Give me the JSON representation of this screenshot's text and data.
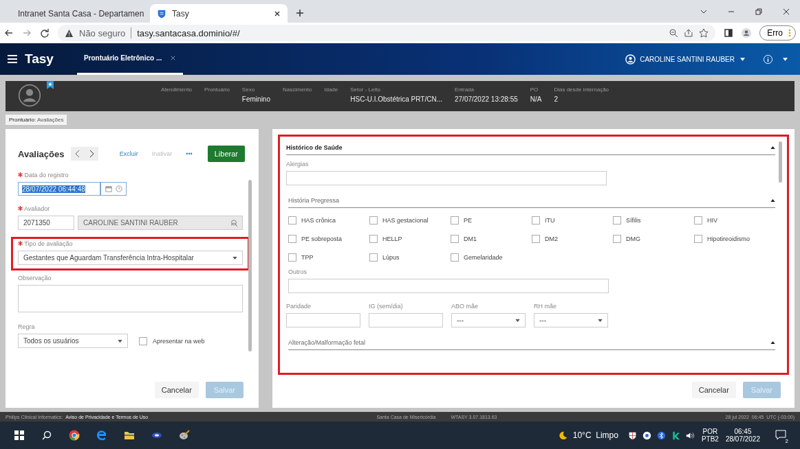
{
  "browser": {
    "tabs": [
      {
        "title": "Intranet Santa Casa - Departamen",
        "selected": false
      },
      {
        "title": "Tasy",
        "selected": true
      }
    ],
    "address": {
      "warning": "Não seguro",
      "url": "tasy.santacasa.dominio/#/"
    },
    "profile_button": "Erro"
  },
  "app_header": {
    "logo": "Tasy",
    "tab": "Prontuário Eletrônico ...",
    "user": "CAROLINE SANTINI RAUBER"
  },
  "patient_bar": [
    {
      "label": "Atendimento"
    },
    {
      "label": "Prontuário"
    },
    {
      "label": "Sexo",
      "value": "Feminino"
    },
    {
      "label": "Nascimento"
    },
    {
      "label": "Idade"
    },
    {
      "label": "Setor - Leito",
      "value": "HSC-U.I.Obstétrica PRT/CN..."
    },
    {
      "label": "Entrada",
      "value": "27/07/2022 13:28:55"
    },
    {
      "label": "PO",
      "value": "N/A"
    },
    {
      "label": "Dias desde internação",
      "value": "2"
    }
  ],
  "breadcrumb": {
    "prefix": "Prontuário:",
    "current": "Avaliações"
  },
  "left_panel": {
    "title": "Avaliações",
    "actions": [
      {
        "label": "Excluir",
        "disabled": false
      },
      {
        "label": "Inativar",
        "disabled": true
      },
      {
        "label": "•••",
        "disabled": false
      }
    ],
    "primary_button": "Liberar",
    "date_field": {
      "label": "Data do registro",
      "required": true,
      "value": "28/07/2022 06:44:48"
    },
    "evaluator_field": {
      "label": "Avaliador",
      "required": true,
      "code": "2071350",
      "name": "CAROLINE SANTINI RAUBER"
    },
    "type_field": {
      "label": "Tipo de avaliação",
      "required": true,
      "value": "Gestantes que Aguardam Transferência Intra-Hospitalar",
      "highlighted": true
    },
    "observation_field": {
      "label": "Observação"
    },
    "rule_field": {
      "label": "Regra",
      "value": "Todos os usuários"
    },
    "web_checkbox": {
      "label": "Apresentar na web",
      "checked": false
    },
    "buttons": [
      {
        "label": "Cancelar",
        "disabled": false
      },
      {
        "label": "Salvar",
        "disabled": true
      }
    ]
  },
  "right_panel": {
    "highlighted": true,
    "section": "Histórico de Saúde",
    "allergies_label": "Alergias",
    "subsection": "História Pregressa",
    "checkboxes": [
      {
        "label": "HAS crônica",
        "checked": false
      },
      {
        "label": "HAS gestacional",
        "checked": false
      },
      {
        "label": "PE",
        "checked": false
      },
      {
        "label": "ITU",
        "checked": false
      },
      {
        "label": "Sífilis",
        "checked": false
      },
      {
        "label": "HIV",
        "checked": false
      },
      {
        "label": "PE sobreposta",
        "checked": false
      },
      {
        "label": "HELLP",
        "checked": false
      },
      {
        "label": "DM1",
        "checked": false
      },
      {
        "label": "DM2",
        "checked": false
      },
      {
        "label": "DMG",
        "checked": false
      },
      {
        "label": "Hipotireoidismo",
        "checked": false
      },
      {
        "label": "TPP",
        "checked": false
      },
      {
        "label": "Lúpus",
        "checked": false
      },
      {
        "label": "Gemelaridade",
        "checked": false
      }
    ],
    "others_label": "Outros",
    "small_fields": [
      {
        "label": "Paridade",
        "kind": "input"
      },
      {
        "label": "IG (sem/dia)",
        "kind": "input"
      },
      {
        "label": "ABO mãe",
        "kind": "select",
        "value": "---"
      },
      {
        "label": "RH mãe",
        "kind": "select",
        "value": "---"
      }
    ],
    "next_section": "Alteração/Malformação fetal",
    "buttons": [
      {
        "label": "Cancelar",
        "disabled": false
      },
      {
        "label": "Salvar",
        "disabled": true
      }
    ]
  },
  "status_bar": {
    "company": "Philips Clinical Informatics:",
    "link": "Aviso de Privacidade e Termos de Uso",
    "institution": "Santa Casa de Misericórdia",
    "version": "WTASY 3.07.1813.63",
    "datetime": "28 jul 2022  06:45  UTC (-03:00)"
  },
  "taskbar": {
    "weather": "10°C  Limpo",
    "language": "POR",
    "layout": "PTB2",
    "time": "06:45",
    "date": "28/07/2022",
    "notifications": "2"
  }
}
